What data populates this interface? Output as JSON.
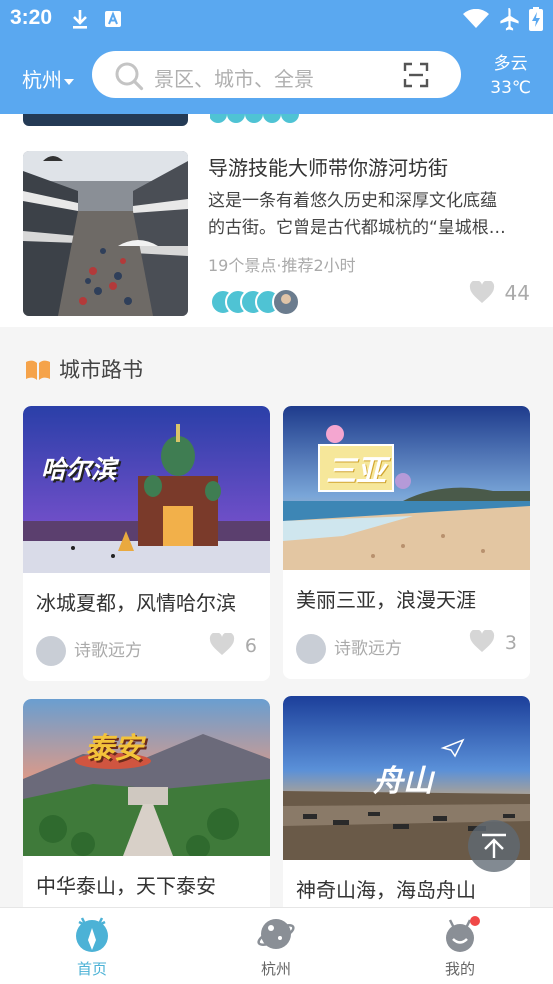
{
  "status_bar": {
    "time": "3:20",
    "icons": [
      "download-icon",
      "text-a-icon",
      "wifi-icon",
      "airplane-icon",
      "battery-charging-icon"
    ]
  },
  "header": {
    "city": "杭州",
    "search_placeholder": "景区、城市、全景",
    "weather_condition": "多云",
    "weather_temp": "33℃"
  },
  "route": {
    "title": "导游技能大师带你游河坊街",
    "desc_line1": "这是一条有着悠久历史和深厚文化底蕴",
    "desc_line2": "的古街。它曾是古代都城杭的“皇城根…",
    "meta": "19个景点·推荐2小时",
    "likes": "44"
  },
  "section": {
    "title": "城市路书"
  },
  "cards": [
    {
      "title": "冰城夏都，风情哈尔滨",
      "author": "诗歌远方",
      "likes": "6",
      "image_text": "哈尔滨"
    },
    {
      "title": "美丽三亚，浪漫天涯",
      "author": "诗歌远方",
      "likes": "3",
      "image_text": "三亚"
    },
    {
      "title": "中华泰山，天下泰安",
      "image_text": "泰安"
    },
    {
      "title": "神奇山海，海岛舟山",
      "image_text": "舟山"
    }
  ],
  "tabs": [
    {
      "label": "首页",
      "icon": "deer-icon",
      "active": true
    },
    {
      "label": "杭州",
      "icon": "planet-icon",
      "active": false
    },
    {
      "label": "我的",
      "icon": "profile-deer-icon",
      "active": false
    }
  ],
  "colors": {
    "brand_blue": "#5aa8f0",
    "active_tab": "#4cb2d6",
    "badge_red": "#f04848"
  }
}
